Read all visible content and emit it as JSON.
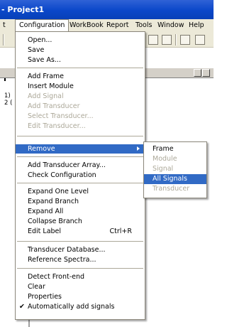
{
  "titlebar": {
    "text": "- Project1"
  },
  "menubar": {
    "items": [
      {
        "label": "t",
        "active": false
      },
      {
        "label": "Configuration",
        "active": true
      },
      {
        "label": "WorkBook",
        "active": false
      },
      {
        "label": "Report",
        "active": false
      },
      {
        "label": "Tools",
        "active": false
      },
      {
        "label": "Window",
        "active": false
      },
      {
        "label": "Help",
        "active": false
      }
    ]
  },
  "background": {
    "line1": "1)",
    "line2": "2 ("
  },
  "menu": {
    "items": [
      {
        "label": "Open...",
        "enabled": true
      },
      {
        "label": "Save",
        "enabled": true
      },
      {
        "label": "Save As...",
        "enabled": true
      },
      {
        "label": "Add Frame",
        "enabled": true
      },
      {
        "label": "Insert Module",
        "enabled": true
      },
      {
        "label": "Add Signal",
        "enabled": false
      },
      {
        "label": "Add Transducer",
        "enabled": false
      },
      {
        "label": "Select Transducer...",
        "enabled": false
      },
      {
        "label": "Edit Transducer...",
        "enabled": false
      },
      {
        "label": "Remove",
        "enabled": true,
        "highlighted": true,
        "submenu": true
      },
      {
        "label": "Add Transducer Array...",
        "enabled": true
      },
      {
        "label": "Check Configuration",
        "enabled": true
      },
      {
        "label": "Expand One Level",
        "enabled": true
      },
      {
        "label": "Expand Branch",
        "enabled": true
      },
      {
        "label": "Expand All",
        "enabled": true
      },
      {
        "label": "Collapse Branch",
        "enabled": true
      },
      {
        "label": "Edit Label",
        "enabled": true,
        "shortcut": "Ctrl+R"
      },
      {
        "label": "Transducer Database...",
        "enabled": true
      },
      {
        "label": "Reference Spectra...",
        "enabled": true
      },
      {
        "label": "Detect Front-end",
        "enabled": true
      },
      {
        "label": "Clear",
        "enabled": true
      },
      {
        "label": "Properties",
        "enabled": true
      },
      {
        "label": "Automatically add signals",
        "enabled": true,
        "checked": true,
        "check_glyph": "✔"
      }
    ]
  },
  "submenu": {
    "items": [
      {
        "label": "Frame",
        "enabled": true
      },
      {
        "label": "Module",
        "enabled": false
      },
      {
        "label": "Signal",
        "enabled": false
      },
      {
        "label": "All Signals",
        "enabled": true,
        "highlighted": true
      },
      {
        "label": "Transducer",
        "enabled": false
      }
    ]
  },
  "colors": {
    "title_bar": "#0a47c9",
    "highlight": "#316ac5",
    "disabled": "#aca899",
    "menu_bar": "#ece9d8"
  }
}
